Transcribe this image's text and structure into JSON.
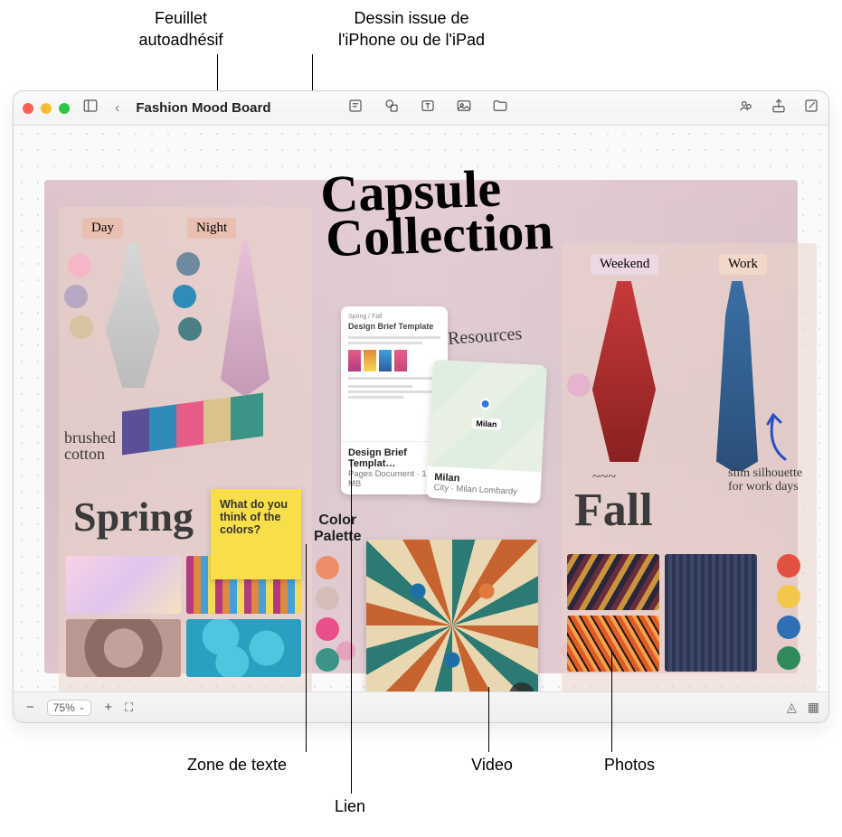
{
  "callouts": {
    "sticky": "Feuillet\nautoadhésif",
    "sketch": "Dessin issue de\nl'iPhone ou de l'iPad",
    "textbox": "Zone de texte",
    "link": "Lien",
    "video": "Video",
    "photos": "Photos"
  },
  "window": {
    "title": "Fashion Mood Board"
  },
  "canvas": {
    "title_line1": "Capsule",
    "title_line2": "Collection",
    "spring": {
      "tag_day": "Day",
      "tag_night": "Night",
      "fabric_note": "brushed cotton",
      "heading": "Spring",
      "swatches_day": [
        "#f6b6c7",
        "#b6a7c4",
        "#d9c2a0"
      ],
      "swatches_night": [
        "#6f8aa0",
        "#2f8cb8",
        "#4a7f86"
      ]
    },
    "sticky": "What do you think of the colors?",
    "text_box": "Color\nPalette",
    "doc_card": {
      "thumb_title": "Design Brief Template",
      "thumb_sub": "Spring / Fall",
      "footer_title": "Design Brief Templat…",
      "footer_sub": "Pages Document · 1 MB"
    },
    "map_card": {
      "label": "Milan",
      "footer_title": "Milan",
      "footer_sub": "City · Milan Lombardy"
    },
    "resources_hand": "Resources",
    "fall": {
      "tag_weekend": "Weekend",
      "tag_work": "Work",
      "heading": "Fall",
      "note_left": "",
      "note_right": "slim silhouette for work days"
    },
    "palette_left": [
      "#ec8f68",
      "#d5bcb8",
      "#ea4f8b",
      "#3b9486"
    ],
    "palette_right": [
      "#e35240",
      "#f2c84b",
      "#2f6fb3",
      "#2f8b5a"
    ]
  },
  "zoom": {
    "level": "75%"
  }
}
